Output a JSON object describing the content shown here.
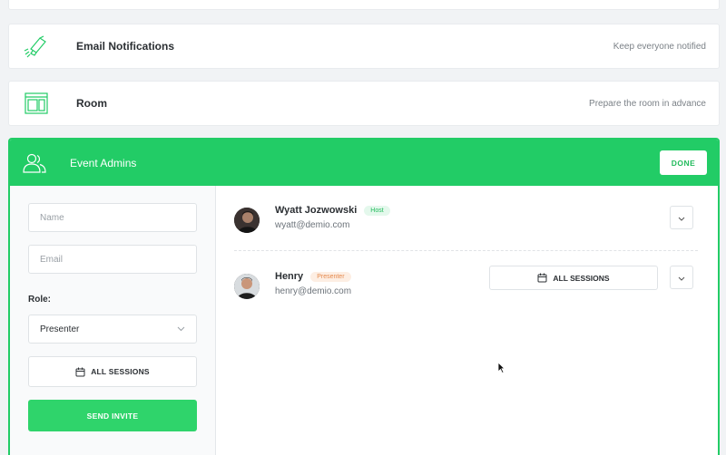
{
  "email_notifications": {
    "title": "Email Notifications",
    "description": "Keep everyone notified"
  },
  "room": {
    "title": "Room",
    "description": "Prepare the room in advance"
  },
  "event_admins": {
    "title": "Event Admins",
    "done_label": "DONE",
    "form": {
      "name_placeholder": "Name",
      "email_placeholder": "Email",
      "role_label": "Role:",
      "role_value": "Presenter",
      "sessions_label": "ALL SESSIONS",
      "send_label": "SEND INVITE"
    },
    "admins": [
      {
        "name": "Wyatt Jozwowski",
        "badge": "Host",
        "email": "wyatt@demio.com"
      },
      {
        "name": "Henry",
        "badge": "Presenter",
        "email": "henry@demio.com",
        "sessions_label": "ALL SESSIONS"
      }
    ]
  },
  "colors": {
    "accent": "#22cc66",
    "host_badge": "#22bb5c",
    "presenter_badge": "#e58a4e"
  }
}
